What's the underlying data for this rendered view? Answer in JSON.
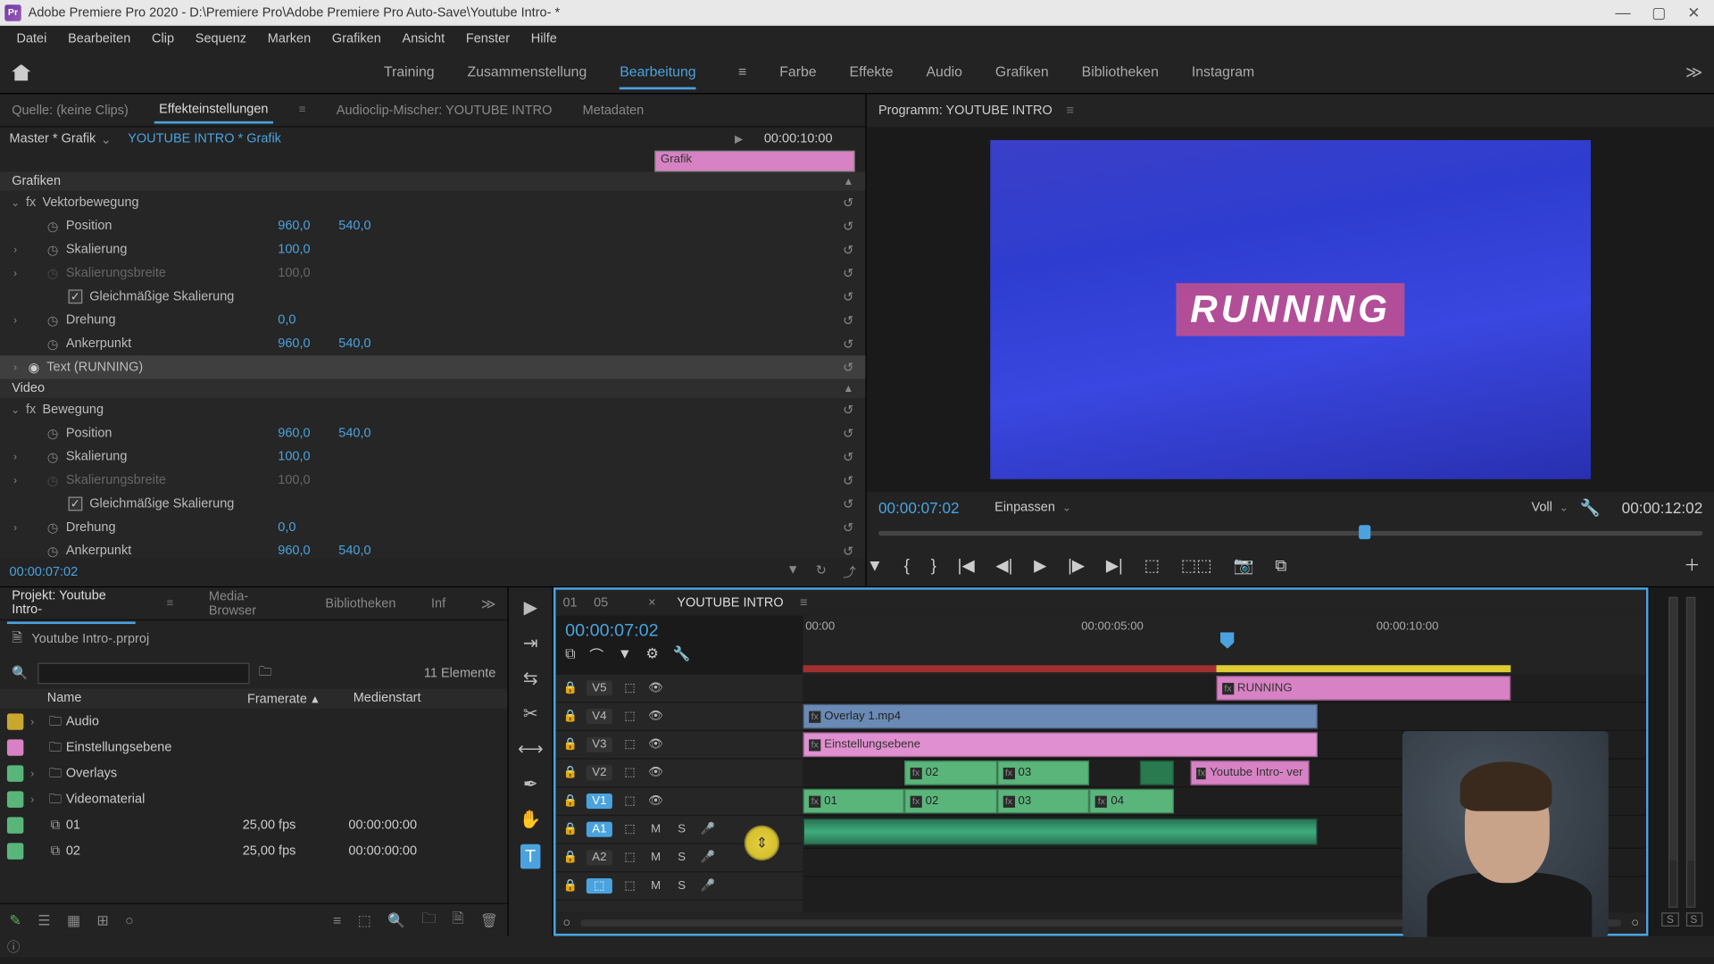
{
  "titlebar": {
    "app_prefix": "Pr",
    "title": "Adobe Premiere Pro 2020 - D:\\Premiere Pro\\Adobe Premiere Pro Auto-Save\\Youtube Intro- *"
  },
  "menubar": [
    "Datei",
    "Bearbeiten",
    "Clip",
    "Sequenz",
    "Marken",
    "Grafiken",
    "Ansicht",
    "Fenster",
    "Hilfe"
  ],
  "workspaces": {
    "items": [
      "Training",
      "Zusammenstellung",
      "Bearbeitung",
      "Farbe",
      "Effekte",
      "Audio",
      "Grafiken",
      "Bibliotheken",
      "Instagram"
    ],
    "active_index": 2
  },
  "source_panel": {
    "tabs": [
      "Quelle: (keine Clips)",
      "Effekteinstellungen",
      "Audioclip-Mischer: YOUTUBE INTRO",
      "Metadaten"
    ],
    "active_index": 1,
    "master_label": "Master * Grafik",
    "clip_label": "YOUTUBE INTRO * Grafik",
    "timeline_timecode": "00:00:10:00",
    "grafik_clip_label": "Grafik",
    "sections": {
      "grafiken": "Grafiken",
      "video": "Video"
    },
    "effects": {
      "vektorbewegung": "Vektorbewegung",
      "bewegung": "Bewegung",
      "text_running": "Text (RUNNING)",
      "position": "Position",
      "skalierung": "Skalierung",
      "skalierungsbreite": "Skalierungsbreite",
      "gleichmaessig": "Gleichmäßige Skalierung",
      "drehung": "Drehung",
      "ankerpunkt": "Ankerpunkt",
      "pos_x": "960,0",
      "pos_y": "540,0",
      "scale_val": "100,0",
      "rotation_val": "0,0"
    },
    "footer_tc": "00:00:07:02"
  },
  "program": {
    "title": "Programm: YOUTUBE INTRO",
    "running_text": "RUNNING",
    "tc_left": "00:00:07:02",
    "fit_label": "Einpassen",
    "quality_label": "Voll",
    "tc_right": "00:00:12:02"
  },
  "project": {
    "tabs": [
      "Projekt: Youtube Intro-",
      "Media-Browser",
      "Bibliotheken",
      "Inf"
    ],
    "active_index": 0,
    "filename": "Youtube Intro-.prproj",
    "item_count": "11 Elemente",
    "headers": {
      "name": "Name",
      "framerate": "Framerate",
      "medienstart": "Medienstart"
    },
    "items": [
      {
        "color": "#c9a830",
        "name": "Audio",
        "type": "folder"
      },
      {
        "color": "#d782c4",
        "name": "Einstellungsebene",
        "type": "folder"
      },
      {
        "color": "#5ab57a",
        "name": "Overlays",
        "type": "folder"
      },
      {
        "color": "#5ab57a",
        "name": "Videomaterial",
        "type": "folder"
      },
      {
        "color": "#5ab57a",
        "name": "01",
        "type": "sequence",
        "fr": "25,00 fps",
        "ms": "00:00:00:00"
      },
      {
        "color": "#5ab57a",
        "name": "02",
        "type": "sequence",
        "fr": "25,00 fps",
        "ms": "00:00:00:00"
      }
    ]
  },
  "timeline": {
    "tabs": [
      "01",
      "05",
      "YOUTUBE INTRO"
    ],
    "active_index": 2,
    "tc": "00:00:07:02",
    "ruler": {
      "t0": "00:00",
      "t1": "00:00:05:00",
      "t2": "00:00:10:00"
    },
    "tracks": {
      "v5": "V5",
      "v4": "V4",
      "v3": "V3",
      "v2": "V2",
      "v1": "V1",
      "a1": "A1",
      "a2": "A2",
      "m": "M",
      "s": "S"
    },
    "clips": {
      "running": "RUNNING",
      "overlay": "Overlay 1.mp4",
      "einstellungsebene": "Einstellungsebene",
      "youtube_intro_ver": "Youtube Intro- ver",
      "c01": "01",
      "c02": "02",
      "c03": "03",
      "c04": "04"
    }
  },
  "audio_meters": {
    "solo": "S"
  }
}
